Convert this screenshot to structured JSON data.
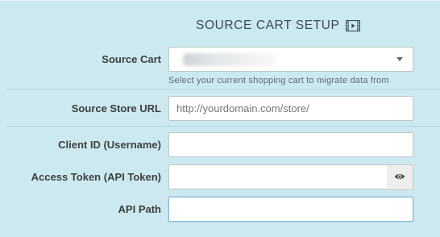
{
  "header": {
    "title": "SOURCE CART SETUP",
    "title_icon": "video-icon"
  },
  "source_cart": {
    "label": "Source Cart",
    "value": "",
    "help_text": "Select your current shopping cart to migrate data from"
  },
  "source_store_url": {
    "label": "Source Store URL",
    "value": "",
    "placeholder": "http://yourdomain.com/store/"
  },
  "client_id": {
    "label": "Client ID (Username)",
    "value": ""
  },
  "access_token": {
    "label": "Access Token (API Token)",
    "value": "",
    "toggle_icon": "eye-icon"
  },
  "api_path": {
    "label": "API Path",
    "value": ""
  },
  "colors": {
    "panel_bg": "#cde9f0",
    "label_text": "#3b3f44",
    "input_border": "#b9c7cc"
  }
}
